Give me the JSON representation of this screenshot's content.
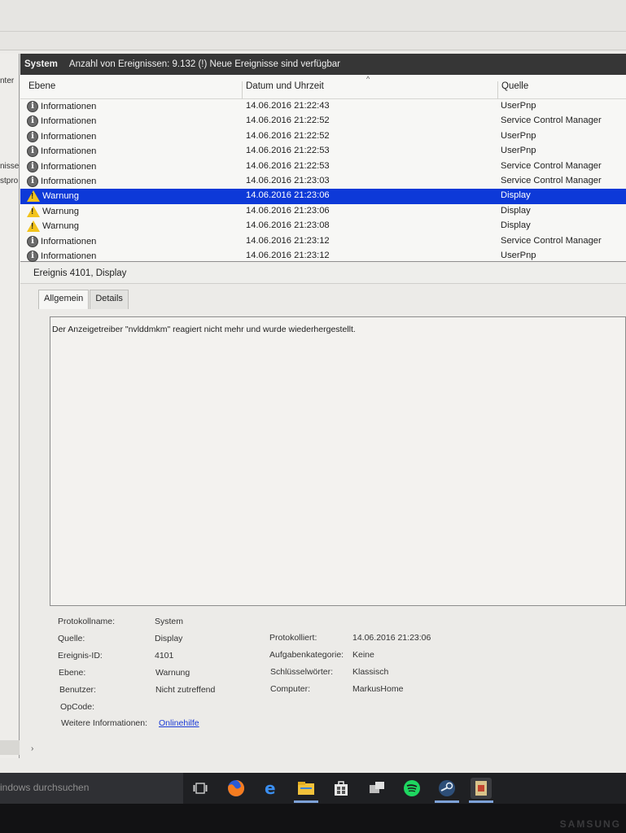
{
  "left_pane": {
    "fragments": [
      "nter",
      "nisse",
      "stpro"
    ]
  },
  "title_bar": {
    "log_name": "System",
    "event_count": "Anzahl von Ereignissen: 9.132 (!) Neue Ereignisse sind verfügbar"
  },
  "list": {
    "columns": [
      "Ebene",
      "Datum und Uhrzeit",
      "Quelle"
    ],
    "sort_indicator": "^",
    "rows": [
      {
        "level": "Informationen",
        "date": "14.06.2016 21:22:43",
        "source": "UserPnp",
        "type": "info"
      },
      {
        "level": "Informationen",
        "date": "14.06.2016 21:22:52",
        "source": "Service Control Manager",
        "type": "info"
      },
      {
        "level": "Informationen",
        "date": "14.06.2016 21:22:52",
        "source": "UserPnp",
        "type": "info"
      },
      {
        "level": "Informationen",
        "date": "14.06.2016 21:22:53",
        "source": "UserPnp",
        "type": "info"
      },
      {
        "level": "Informationen",
        "date": "14.06.2016 21:22:53",
        "source": "Service Control Manager",
        "type": "info"
      },
      {
        "level": "Informationen",
        "date": "14.06.2016 21:23:03",
        "source": "Service Control Manager",
        "type": "info"
      },
      {
        "level": "Warnung",
        "date": "14.06.2016 21:23:06",
        "source": "Display",
        "type": "warn",
        "selected": true
      },
      {
        "level": "Warnung",
        "date": "14.06.2016 21:23:06",
        "source": "Display",
        "type": "warn"
      },
      {
        "level": "Warnung",
        "date": "14.06.2016 21:23:08",
        "source": "Display",
        "type": "warn"
      },
      {
        "level": "Informationen",
        "date": "14.06.2016 21:23:12",
        "source": "Service Control Manager",
        "type": "info"
      },
      {
        "level": "Informationen",
        "date": "14.06.2016 21:23:12",
        "source": "UserPnp",
        "type": "info"
      }
    ]
  },
  "detail": {
    "header": "Ereignis 4101, Display",
    "tabs": [
      "Allgemein",
      "Details"
    ],
    "active_tab": "Allgemein",
    "message": "Der Anzeigetreiber \"nvlddmkm\" reagiert nicht mehr und wurde wiederhergestellt.",
    "props": {
      "protokollname_label": "Protokollname:",
      "protokollname": "System",
      "quelle_label": "Quelle:",
      "quelle": "Display",
      "protokolliert_label": "Protokolliert:",
      "protokolliert": "14.06.2016 21:23:06",
      "ereignis_id_label": "Ereignis-ID:",
      "ereignis_id": "4101",
      "aufgabenkategorie_label": "Aufgabenkategorie:",
      "aufgabenkategorie": "Keine",
      "ebene_label": "Ebene:",
      "ebene": "Warnung",
      "schluesselwoerter_label": "Schlüsselwörter:",
      "schluesselwoerter": "Klassisch",
      "benutzer_label": "Benutzer:",
      "benutzer": "Nicht zutreffend",
      "computer_label": "Computer:",
      "computer": "MarkusHome",
      "opcode_label": "OpCode:",
      "weitere_label": "Weitere Informationen:",
      "onlinehilfe": "Onlinehilfe"
    }
  },
  "taskbar": {
    "search_placeholder": "indows durchsuchen",
    "icons": [
      "task-view-icon",
      "firefox-icon",
      "edge-icon",
      "file-explorer-icon",
      "store-icon",
      "network-app-icon",
      "spotify-icon",
      "steam-icon",
      "event-viewer-icon"
    ]
  },
  "colors": {
    "selection": "#0d39d8",
    "title_bar": "#363636",
    "warning": "#f2c31a",
    "link": "#1a3ad6"
  }
}
